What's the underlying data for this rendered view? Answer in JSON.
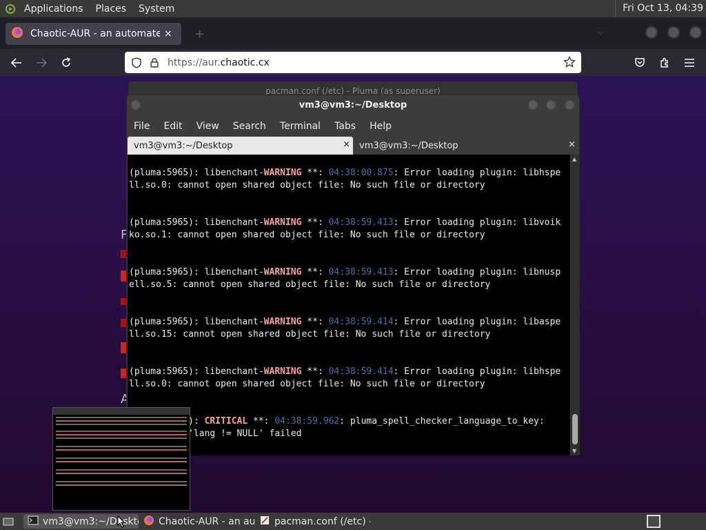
{
  "top_panel": {
    "menus": [
      "Applications",
      "Places",
      "System"
    ],
    "clock": "Fri Oct 13, 04:39"
  },
  "firefox": {
    "tab_title": "Chaotic-AUR - an automated bu",
    "tab_close": "×",
    "new_tab": "+",
    "url_host_prefix": "https://aur.",
    "url_domain": "chaotic.cx",
    "bg_fragments": [
      "F",
      "A"
    ]
  },
  "pluma_window": {
    "title": "pacman.conf (/etc) - Pluma (as superuser)"
  },
  "terminal": {
    "title": "vm3@vm3:~/Desktop",
    "menu": [
      "File",
      "Edit",
      "View",
      "Search",
      "Terminal",
      "Tabs",
      "Help"
    ],
    "tabs": [
      {
        "label": "vm3@vm3:~/Desktop",
        "close": "×"
      },
      {
        "label": "vm3@vm3:~/Desktop",
        "close": "×"
      }
    ],
    "lines": [
      {
        "pre": "(pluma:5965): libenchant-",
        "level": "WARNING",
        "stars": " **: ",
        "ts": "04:38:00.875",
        "msg": ": Error loading plugin: libhspe",
        "cont": "ll.so.0: cannot open shared object file: No such file or directory"
      },
      {
        "pre": "(pluma:5965): libenchant-",
        "level": "WARNING",
        "stars": " **: ",
        "ts": "04:38:59.413",
        "msg": ": Error loading plugin: libvoik",
        "cont": "ko.so.1: cannot open shared object file: No such file or directory"
      },
      {
        "pre": "(pluma:5965): libenchant-",
        "level": "WARNING",
        "stars": " **: ",
        "ts": "04:38:59.413",
        "msg": ": Error loading plugin: libnusp",
        "cont": "ell.so.5: cannot open shared object file: No such file or directory"
      },
      {
        "pre": "(pluma:5965): libenchant-",
        "level": "WARNING",
        "stars": " **: ",
        "ts": "04:38:59.414",
        "msg": ": Error loading plugin: libaspe",
        "cont": "ll.so.15: cannot open shared object file: No such file or directory"
      },
      {
        "pre": "(pluma:5965): libenchant-",
        "level": "WARNING",
        "stars": " **: ",
        "ts": "04:38:59.414",
        "msg": ": Error loading plugin: libhspe",
        "cont": "ll.so.0: cannot open shared object file: No such file or directory"
      },
      {
        "pre": "(pluma:5965): ",
        "level": "CRITICAL",
        "stars": " **: ",
        "ts": "04:38:59.962",
        "msg": ": pluma_spell_checker_language_to_key:",
        "cont": " assertion 'lang != NULL' failed"
      }
    ]
  },
  "taskbar": {
    "tasks": [
      {
        "label": "vm3@vm3:~/Desktop"
      },
      {
        "label": "Chaotic-AUR - an au..."
      },
      {
        "label": "pacman.conf (/etc) -..."
      }
    ]
  },
  "colors": {
    "warning": "#f4a3a3",
    "timestamp": "#4f6ea8",
    "terminal_bg": "#000000",
    "page_bg": "#2a1356"
  }
}
